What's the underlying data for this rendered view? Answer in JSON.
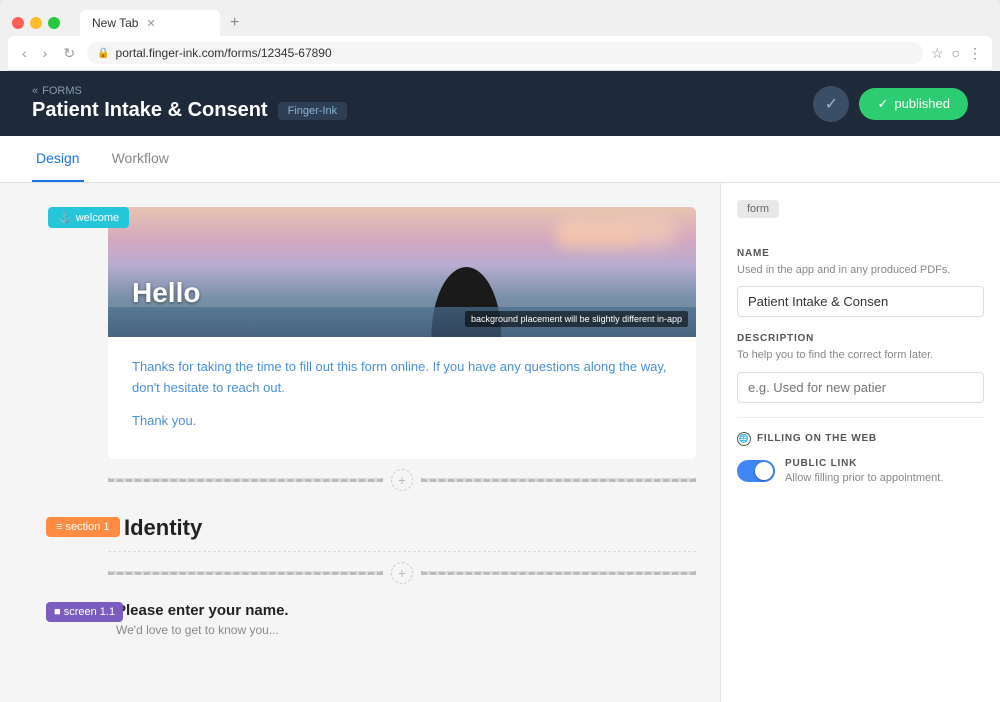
{
  "browser": {
    "tab_title": "New Tab",
    "url": "portal.finger-ink.com/forms/12345-67890",
    "new_tab_label": "+"
  },
  "header": {
    "breadcrumb_arrow": "«",
    "breadcrumb_label": "FORMS",
    "form_title": "Patient Intake & Consent",
    "badge_label": "Finger-Ink",
    "published_label": "published",
    "check_icon": "✓"
  },
  "tabs": [
    {
      "label": "Design",
      "active": true
    },
    {
      "label": "Workflow",
      "active": false
    }
  ],
  "welcome_tag": "⚓ welcome",
  "hero": {
    "text": "Hello",
    "notice": "background placement will be slightly different in-app"
  },
  "welcome_body": {
    "paragraph": "Thanks for taking the time to fill out this form online. If you have any questions along the way, don't hesitate to reach out.",
    "closing": "Thank you."
  },
  "section1": {
    "tag": "≡ section 1",
    "title": "Identity"
  },
  "screen1": {
    "tag": "■ screen 1.1",
    "question": "Please enter your name.",
    "subtext": "We'd love to get to know you..."
  },
  "right_panel": {
    "form_tab": "form",
    "name_label": "NAME",
    "name_hint": "Used in the app and in any produced PDFs.",
    "name_value": "Patient Intake & Consen",
    "description_label": "DESCRIPTION",
    "description_hint": "To help you to find the correct form later.",
    "description_placeholder": "e.g. Used for new patier",
    "filling_label": "FILLING ON THE WEB",
    "public_link_label": "PUBLIC LINK",
    "public_link_hint": "Allow filling prior to appointment."
  }
}
